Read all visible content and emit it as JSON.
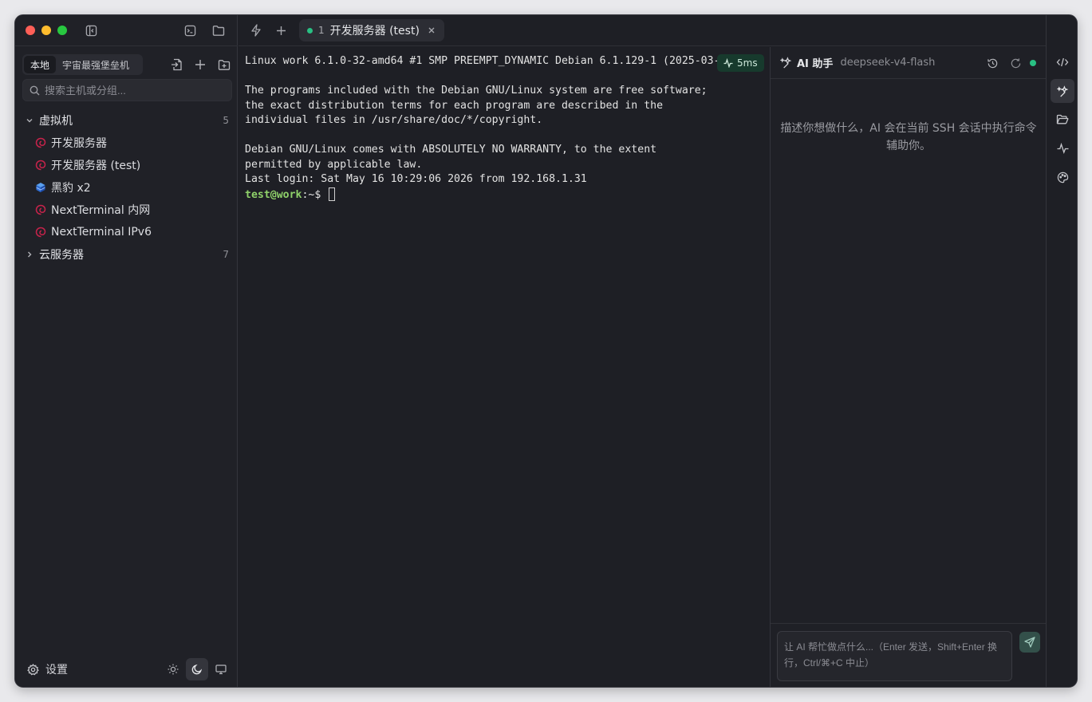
{
  "window": {
    "title_icons": [
      "sidebar-toggle-icon",
      "terminal-icon",
      "folder-icon",
      "lightning-icon",
      "plus-icon"
    ]
  },
  "sidebar": {
    "segments": [
      {
        "label": "本地",
        "active": true
      },
      {
        "label": "宇宙最强堡垒机",
        "active": false
      }
    ],
    "actions": [
      "import-icon",
      "plus-icon",
      "folder-plus-icon"
    ],
    "search_placeholder": "搜索主机或分组...",
    "groups": [
      {
        "name": "虚拟机",
        "count": "5",
        "expanded": true,
        "hosts": [
          {
            "name": "开发服务器",
            "icon": "debian-icon"
          },
          {
            "name": "开发服务器 (test)",
            "icon": "debian-icon"
          },
          {
            "name": "黑豹 x2",
            "icon": "cube-icon"
          },
          {
            "name": "NextTerminal 内网",
            "icon": "debian-icon"
          },
          {
            "name": "NextTerminal IPv6",
            "icon": "debian-icon"
          }
        ]
      },
      {
        "name": "云服务器",
        "count": "7",
        "expanded": false,
        "hosts": []
      }
    ],
    "footer": {
      "settings_label": "设置",
      "theme_options": [
        "sun-icon",
        "moon-icon",
        "monitor-icon"
      ],
      "active_theme": "moon-icon"
    }
  },
  "tabs": [
    {
      "index": "1",
      "label": "开发服务器 (test)",
      "status_color": "#29c083"
    }
  ],
  "terminal": {
    "lines": [
      "Linux work 6.1.0-32-amd64 #1 SMP PREEMPT_DYNAMIC Debian 6.1.129-1 (2025-03-06)",
      "",
      "The programs included with the Debian GNU/Linux system are free software;",
      "the exact distribution terms for each program are described in the",
      "individual files in /usr/share/doc/*/copyright.",
      "",
      "Debian GNU/Linux comes with ABSOLUTELY NO WARRANTY, to the extent",
      "permitted by applicable law.",
      "Last login: Sat May 16 10:29:06 2026 from 192.168.1.31"
    ],
    "prompt_user": "test@work",
    "prompt_suffix": ":~$ ",
    "latency": "5ms"
  },
  "ai_panel": {
    "title": "AI 助手",
    "model": "deepseek-v4-flash",
    "empty_text": "描述你想做什么，AI 会在当前 SSH 会话中执行命令辅助你。",
    "input_placeholder": "让 AI 帮忙做点什么...（Enter 发送，Shift+Enter 换行，Ctrl/⌘+C 中止）",
    "status_color": "#29c083"
  },
  "right_rail": {
    "items": [
      "code-icon",
      "sparkle-icon",
      "folder-open-icon",
      "activity-icon",
      "palette-icon"
    ],
    "active": "sparkle-icon"
  },
  "colors": {
    "accent_green": "#29c083",
    "prompt_green": "#8fd16a",
    "background": "#1e1f25"
  }
}
